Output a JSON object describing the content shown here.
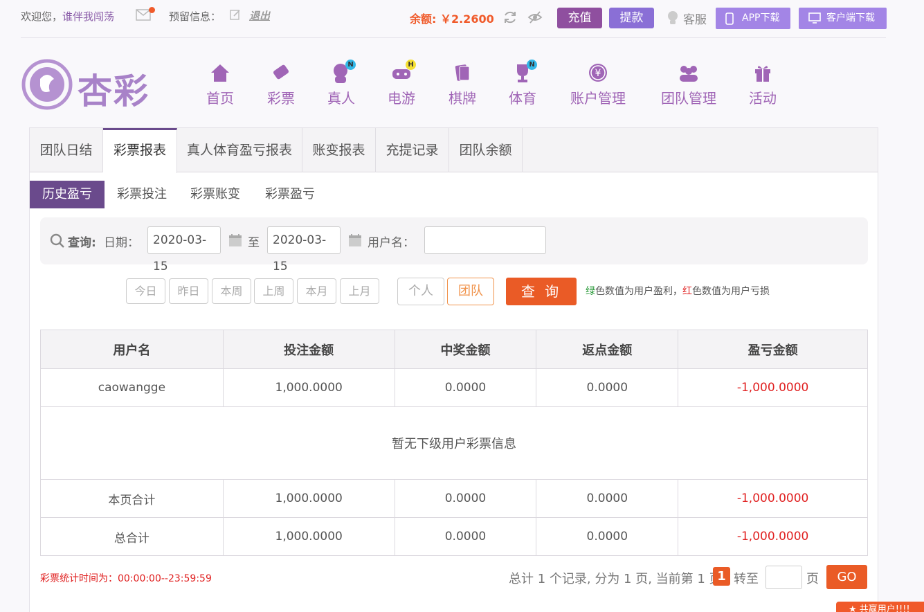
{
  "topbar": {
    "welcome": "欢迎您，",
    "username": "谁伴我闯荡",
    "reserved_info": "预留信息：",
    "logout": "退出",
    "balance": "余额: ￥2.2600",
    "recharge": "充值",
    "withdraw": "提款",
    "customer_service": "客服",
    "app_download": "APP下载",
    "client_download": "客户端下载"
  },
  "logo": {
    "text": "杏彩"
  },
  "nav": [
    {
      "label": "首页",
      "icon": "home-icon"
    },
    {
      "label": "彩票",
      "icon": "lottery-icon"
    },
    {
      "label": "真人",
      "icon": "live-dealer-icon",
      "badge": "N"
    },
    {
      "label": "电游",
      "icon": "gamepad-icon",
      "badge": "H"
    },
    {
      "label": "棋牌",
      "icon": "cards-icon"
    },
    {
      "label": "体育",
      "icon": "trophy-icon",
      "badge": "N"
    },
    {
      "label": "账户管理",
      "icon": "yen-coin-icon"
    },
    {
      "label": "团队管理",
      "icon": "team-icon"
    },
    {
      "label": "活动",
      "icon": "gift-icon"
    }
  ],
  "tabs": [
    "团队日结",
    "彩票报表",
    "真人体育盈亏报表",
    "账变报表",
    "充提记录",
    "团队余额"
  ],
  "subtabs": [
    "历史盈亏",
    "彩票投注",
    "彩票账变",
    "彩票盈亏"
  ],
  "search": {
    "label": "查询:",
    "date_label": "日期：",
    "date_from": "2020-03-15",
    "to": "至",
    "date_to": "2020-03-15",
    "user_label": "用户名：",
    "user_value": ""
  },
  "quick": [
    "今日",
    "昨日",
    "本周",
    "上周",
    "本月",
    "上月"
  ],
  "scope": [
    "个人",
    "团队"
  ],
  "query_button": "查 询",
  "legend": {
    "green": "绿",
    "mid": "色数值为用户盈利，",
    "red": "红",
    "end": "色数值为用户亏损"
  },
  "table": {
    "headers": [
      "用户名",
      "投注金额",
      "中奖金额",
      "返点金额",
      "盈亏金额"
    ],
    "row": [
      "caowangge",
      "1,000.0000",
      "0.0000",
      "0.0000",
      "-1,000.0000"
    ],
    "empty_msg": "暂无下级用户彩票信息",
    "page_total": [
      "本页合计",
      "1,000.0000",
      "0.0000",
      "0.0000",
      "-1,000.0000"
    ],
    "grand_total": [
      "总合计",
      "1,000.0000",
      "0.0000",
      "0.0000",
      "-1,000.0000"
    ]
  },
  "footer": {
    "stat_time": "彩票统计时间为：00:00:00--23:59:59",
    "pager_text": "总计 1 个记录, 分为 1 页, 当前第 1 页",
    "current_page": "1",
    "goto": "转至",
    "page_suffix": "页",
    "go": "GO"
  },
  "float_tab": "★ 共赢用户!!!!"
}
